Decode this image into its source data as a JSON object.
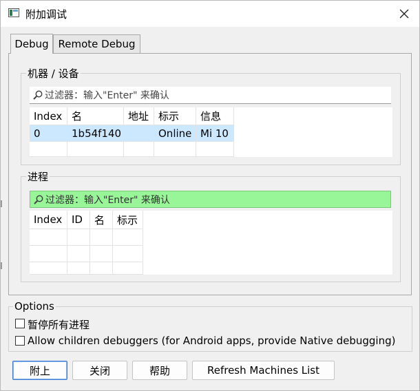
{
  "window": {
    "title": "附加调试",
    "close_label": "✕"
  },
  "tabs": [
    {
      "label": "Debug",
      "active": true
    },
    {
      "label": "Remote Debug",
      "active": false
    }
  ],
  "machines": {
    "group_title": "机器 / 设备",
    "filter_placeholder": "过滤器：输入\"Enter\" 来确认",
    "columns": [
      "Index",
      "名",
      "地址",
      "标示",
      "信息"
    ],
    "rows": [
      {
        "index": "0",
        "name": "1b54f140",
        "address": "",
        "mark": "Online",
        "info": "Mi 10"
      }
    ]
  },
  "processes": {
    "group_title": "进程",
    "filter_placeholder": "过滤器：输入\"Enter\" 来确认",
    "columns": [
      "Index",
      "ID",
      "名",
      "标示"
    ],
    "rows": []
  },
  "options": {
    "title": "Options",
    "pause_all": {
      "label": "暂停所有进程",
      "checked": false
    },
    "allow_children": {
      "label": "Allow children debuggers (for Android apps, provide Native debugging)",
      "checked": false
    }
  },
  "buttons": {
    "attach": "附上",
    "close": "关闭",
    "help": "帮助",
    "refresh": "Refresh Machines List"
  },
  "colors": {
    "filter_active": "#98f598",
    "selection": "#cce8ff",
    "default_button_border": "#3b7bd4"
  }
}
